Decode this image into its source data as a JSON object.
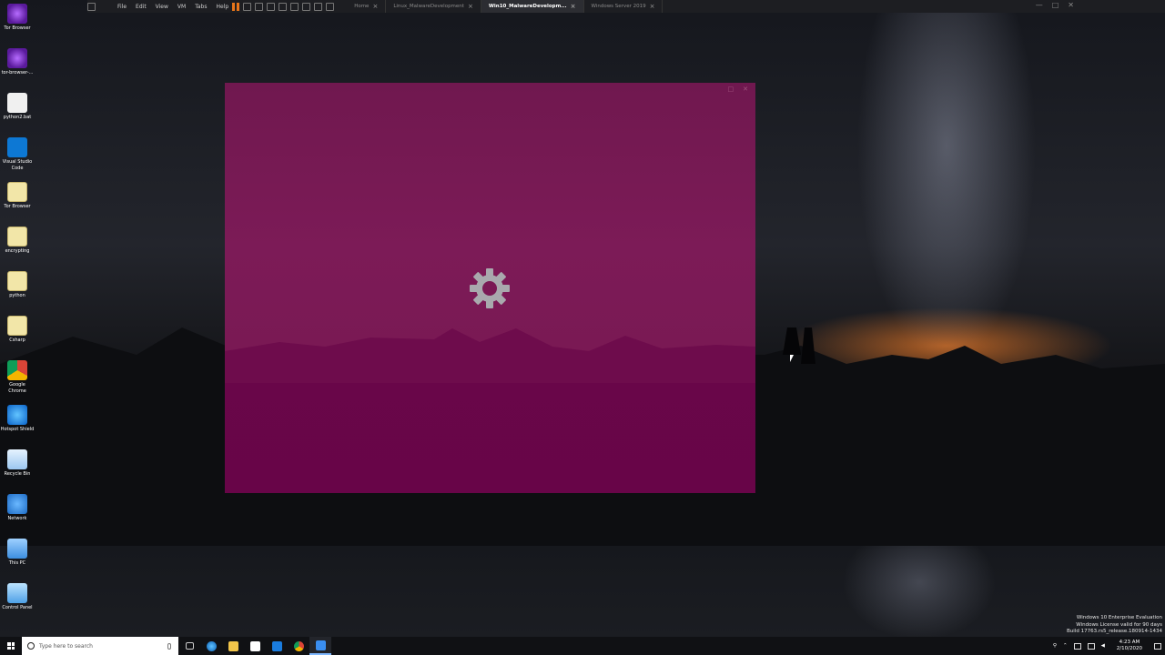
{
  "vmware": {
    "menu": [
      "File",
      "Edit",
      "View",
      "VM",
      "Tabs",
      "Help"
    ],
    "tabs": [
      {
        "label": "Home",
        "active": false
      },
      {
        "label": "Linux_MalwareDevelopment",
        "active": false
      },
      {
        "label": "Win10_MalwareDevelopm...",
        "active": true
      },
      {
        "label": "Windows Server 2019",
        "active": false
      }
    ]
  },
  "desktop_icons": [
    {
      "label": "Tor Browser",
      "icon": "tor-browser-icon"
    },
    {
      "label": "tor-browser-...",
      "icon": "tor-installer-icon"
    },
    {
      "label": "python2.bat",
      "icon": "batch-file-icon"
    },
    {
      "label": "Visual Studio Code",
      "icon": "vscode-icon"
    },
    {
      "label": "Tor Browser",
      "icon": "tor-browser-folder-icon"
    },
    {
      "label": "encrypting",
      "icon": "file-icon"
    },
    {
      "label": "python",
      "icon": "file-icon"
    },
    {
      "label": "Csharp",
      "icon": "file-icon"
    },
    {
      "label": "Google Chrome",
      "icon": "chrome-icon"
    },
    {
      "label": "Hotspot Shield",
      "icon": "hotspot-shield-icon"
    },
    {
      "label": "Recycle Bin",
      "icon": "recycle-bin-icon"
    },
    {
      "label": "Network",
      "icon": "network-icon"
    },
    {
      "label": "This PC",
      "icon": "this-pc-icon"
    },
    {
      "label": "Control Panel",
      "icon": "control-panel-icon"
    }
  ],
  "watermark": {
    "line1": "Windows 10 Enterprise Evaluation",
    "line2": "Windows License valid for 90 days",
    "line3": "Build 17763.rs5_release.180914-1434"
  },
  "taskbar": {
    "search_placeholder": "Type here to search",
    "apps": [
      "task-view-icon",
      "edge-icon",
      "file-explorer-icon",
      "store-icon",
      "mail-icon",
      "chrome-icon",
      "shield-app-icon"
    ],
    "time": "4:23 AM",
    "date": "2/10/2020"
  },
  "colors": {
    "loading_window": "#7a1954",
    "taskbar": "#101114",
    "accent": "#7fb8ff"
  }
}
